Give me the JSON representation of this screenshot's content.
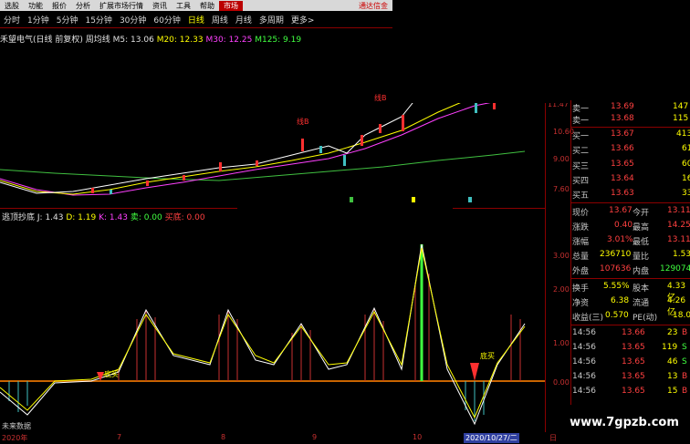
{
  "menu": {
    "items": [
      "选股",
      "功能",
      "报价",
      "分析",
      "扩展市场行情",
      "资讯",
      "工具",
      "帮助"
    ],
    "active": "市场",
    "right": "通达信金"
  },
  "periods": {
    "items": [
      "分时",
      "1分钟",
      "5分钟",
      "15分钟",
      "30分钟",
      "60分钟",
      "日线",
      "周线",
      "月线",
      "多周期",
      "更多>"
    ],
    "selected": "日线"
  },
  "main_legend": {
    "stock": "禾望电气(日线 前复权)",
    "ma_label": "周均线",
    "ma5": "M5: 13.06",
    "ma20": "M20: 12.33",
    "ma30": "M30: 12.25",
    "ma125": "M125: 9.19"
  },
  "main_axis": [
    "11.47",
    "10.60",
    "9.00",
    "7.60"
  ],
  "annotations": {
    "line_b": "线B",
    "line_b2": "线B",
    "sub_tag": "日线"
  },
  "indicator_legend": {
    "name": "逃顶抄底",
    "j": "J: 1.43",
    "d": "D: 1.19",
    "k": "K: 1.43",
    "sell": "卖: 0.00",
    "buy": "买底: 0.00"
  },
  "indicator_axis": [
    "3.00",
    "2.00",
    "1.00",
    "0.00"
  ],
  "indicator_marks": {
    "buy1": "底买",
    "buy2": "底买",
    "note": "未来数据"
  },
  "quote": {
    "sell_rows": [
      {
        "label": "卖一",
        "price": "13.69",
        "vol": "147"
      },
      {
        "label": "卖一",
        "price": "13.68",
        "vol": "115"
      }
    ],
    "buy_rows": [
      {
        "label": "买一",
        "price": "13.67",
        "vol": "413"
      },
      {
        "label": "买二",
        "price": "13.66",
        "vol": "61"
      },
      {
        "label": "买三",
        "price": "13.65",
        "vol": "60"
      },
      {
        "label": "买四",
        "price": "13.64",
        "vol": "16"
      },
      {
        "label": "买五",
        "price": "13.63",
        "vol": "33"
      }
    ],
    "stats": [
      {
        "l1": "现价",
        "v1": "13.67",
        "l2": "今开",
        "v2": "13.11"
      },
      {
        "l1": "涨跌",
        "v1": "0.40",
        "l2": "最高",
        "v2": "14.25"
      },
      {
        "l1": "涨幅",
        "v1": "3.01%",
        "l2": "最低",
        "v2": "13.11"
      },
      {
        "l1": "总量",
        "v1": "236710",
        "l2": "量比",
        "v2": "1.53"
      },
      {
        "l1": "外盘",
        "v1": "107636",
        "l2": "内盘",
        "v2": "129074"
      },
      {
        "l1": "换手",
        "v1": "5.55%",
        "l2": "股本",
        "v2": "4.33亿"
      },
      {
        "l1": "净资",
        "v1": "6.38",
        "l2": "流通",
        "v2": "4.26亿"
      },
      {
        "l1": "收益(三)",
        "v1": "0.570",
        "l2": "PE(动)",
        "v2": "18.0"
      }
    ],
    "ticks": [
      {
        "time": "14:56",
        "price": "13.66",
        "vol": "23",
        "side": "B"
      },
      {
        "time": "14:56",
        "price": "13.65",
        "vol": "119",
        "side": "S"
      },
      {
        "time": "14:56",
        "price": "13.65",
        "vol": "46",
        "side": "S"
      },
      {
        "time": "14:56",
        "price": "13.65",
        "vol": "13",
        "side": "B"
      },
      {
        "time": "14:56",
        "price": "13.65",
        "vol": "15",
        "side": "B"
      }
    ]
  },
  "dates": {
    "d1": "2020年",
    "d2": "7",
    "d3": "8",
    "d4": "9",
    "d5": "10",
    "cursor": "2020/10/27/二",
    "right": "日"
  },
  "watermark": "www.7gpzb.com",
  "colors": {
    "up": "#ff3030",
    "down": "#40c0c0",
    "ma5": "#ffffff",
    "ma20": "#ffff00",
    "ma30": "#ff40ff",
    "ma125": "#40c040"
  }
}
